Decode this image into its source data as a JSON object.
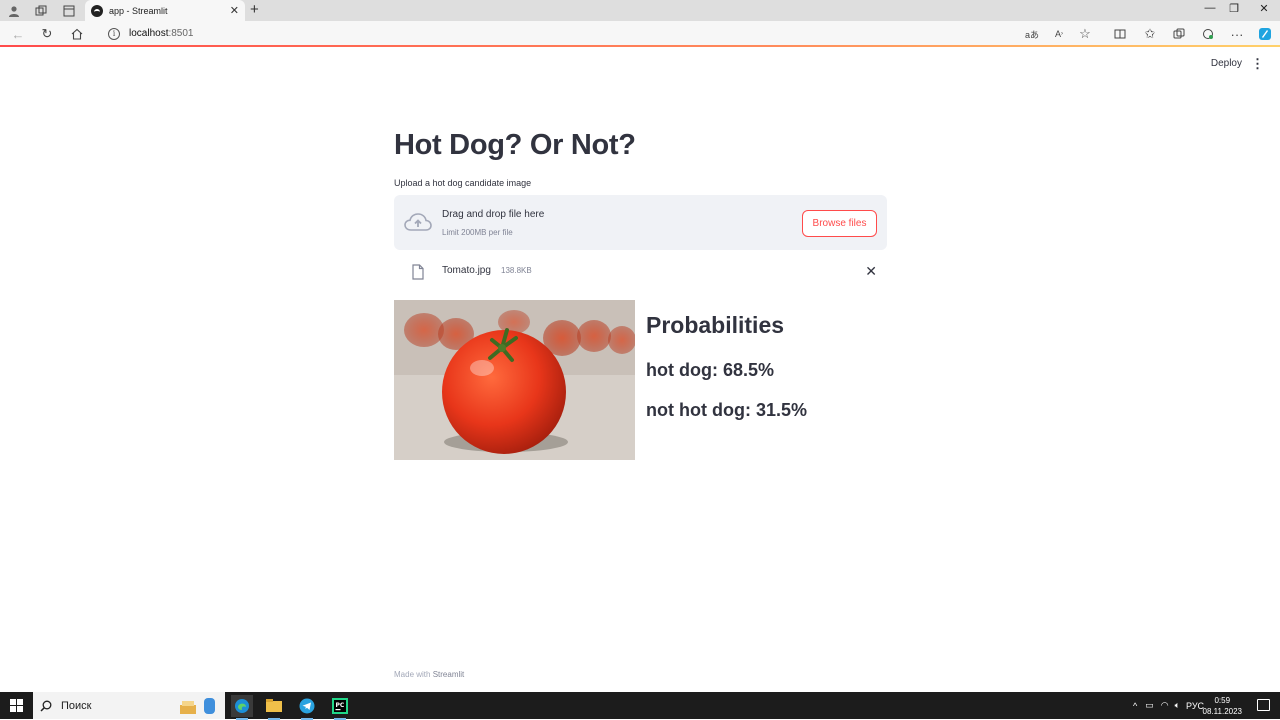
{
  "browser": {
    "tab_title": "app - Streamlit",
    "address_host": "localhost",
    "address_port": ":8501"
  },
  "header": {
    "deploy_label": "Deploy"
  },
  "main": {
    "title": "Hot Dog? Or Not?",
    "uploader_label": "Upload a hot dog candidate image",
    "dropzone_main": "Drag and drop file here",
    "dropzone_sub": "Limit 200MB per file",
    "browse_label": "Browse files",
    "file_name": "Tomato.jpg",
    "file_size": "138.8KB",
    "results_title": "Probabilities",
    "prob_hotdog": "hot dog: 68.5%",
    "prob_not_hotdog": "not hot dog: 31.5%"
  },
  "footer": {
    "made_with": "Made with",
    "brand": "Streamlit"
  },
  "taskbar": {
    "search_text": "Поиск",
    "language": "РУС",
    "time": "0:59",
    "date": "08.11.2023"
  },
  "colors": {
    "accent": "#ff4b4b",
    "text": "#31333f",
    "dropzone_bg": "#f0f2f6"
  }
}
